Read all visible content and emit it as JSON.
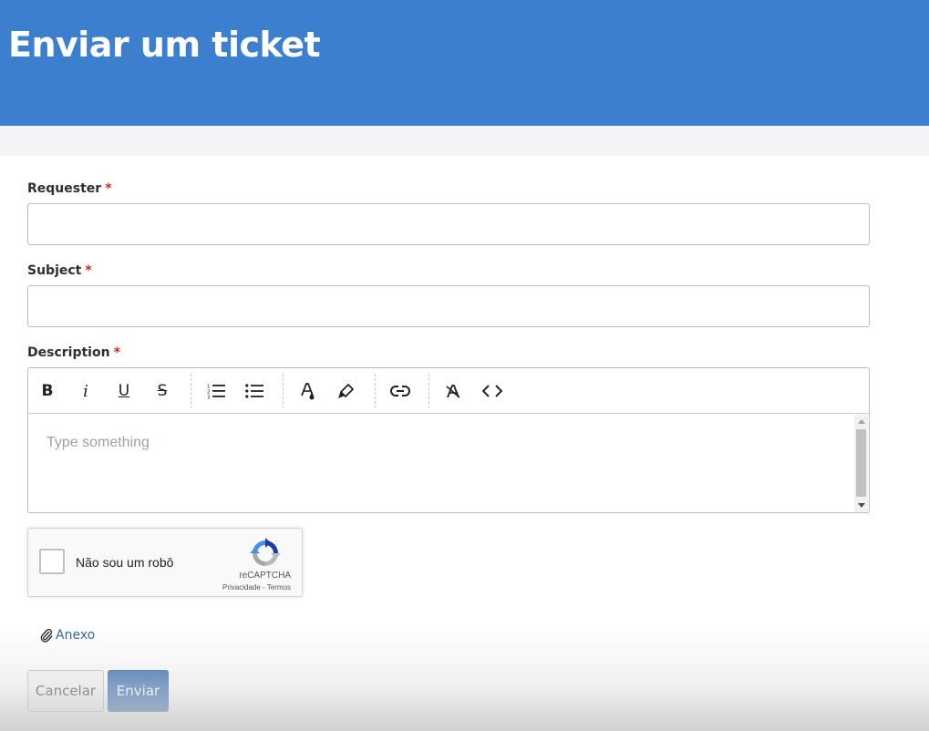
{
  "header": {
    "title": "Enviar um ticket"
  },
  "form": {
    "requester": {
      "label": "Requester",
      "required_mark": "*",
      "value": ""
    },
    "subject": {
      "label": "Subject",
      "required_mark": "*",
      "value": ""
    },
    "description": {
      "label": "Description",
      "required_mark": "*",
      "placeholder": "Type something",
      "toolbar": {
        "bold": "B",
        "italic": "i",
        "underline": "U",
        "strikethrough": "S"
      }
    },
    "captcha": {
      "label": "Não sou um robô",
      "brand": "reCAPTCHA",
      "links": "Privacidade - Termos"
    },
    "attachment": {
      "label": "Anexo",
      "icon": "paperclip-icon"
    },
    "buttons": {
      "cancel": "Cancelar",
      "submit": "Enviar"
    }
  },
  "colors": {
    "header_bg": "#3d7fcf",
    "submit_bg": "#225ca8",
    "link": "#2d5fa8",
    "required": "#c62828"
  }
}
